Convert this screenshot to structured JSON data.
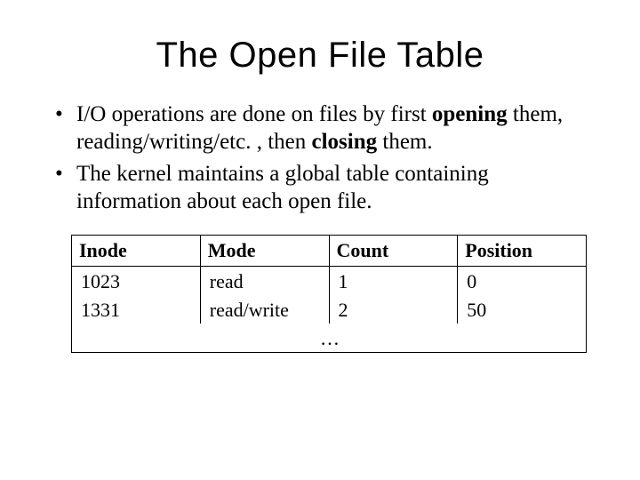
{
  "title": "The Open File Table",
  "bullets": {
    "b1": {
      "t1": "I/O operations are done on files by first ",
      "opening": "opening",
      "t2": " them, reading/writing/etc. , then ",
      "closing": "closing",
      "t3": " them."
    },
    "b2": "The kernel maintains a global table containing information about each open file."
  },
  "table": {
    "headers": {
      "h1": "Inode",
      "h2": "Mode",
      "h3": "Count",
      "h4": "Position"
    },
    "rows": [
      {
        "c1": "1023",
        "c2": "read",
        "c3": "1",
        "c4": "0"
      },
      {
        "c1": "1331",
        "c2": "read/write",
        "c3": "2",
        "c4": "50"
      }
    ],
    "ellipsis": "…"
  }
}
